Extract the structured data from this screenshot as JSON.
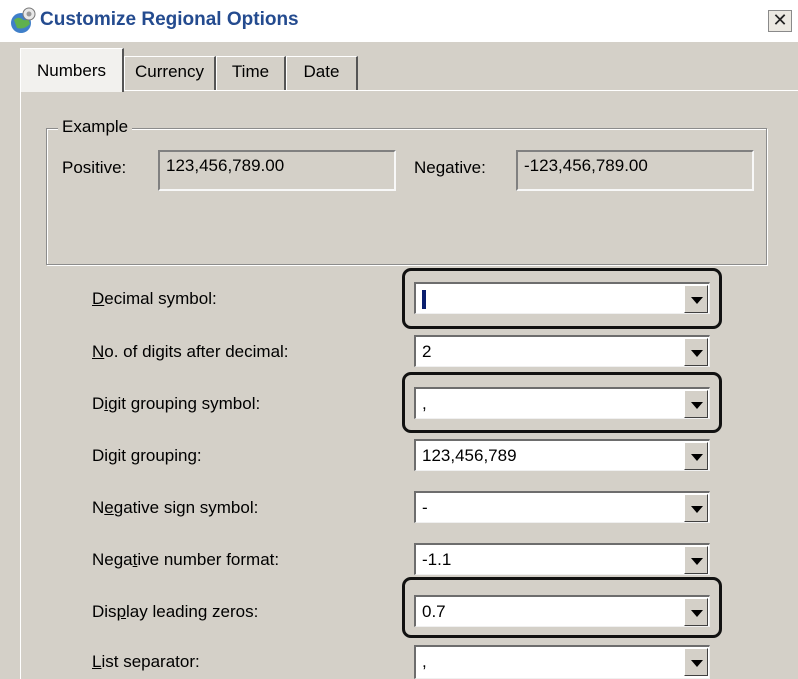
{
  "window": {
    "title": "Customize Regional Options",
    "close_symbol": "✕",
    "icon": "regional-globe-icon"
  },
  "tabs": [
    {
      "label": "Numbers",
      "active": true
    },
    {
      "label": "Currency",
      "active": false
    },
    {
      "label": "Time",
      "active": false
    },
    {
      "label": "Date",
      "active": false
    }
  ],
  "example": {
    "legend": "Example",
    "positive_label": "Positive:",
    "positive_value": "123,456,789.00",
    "negative_label": "Negative:",
    "negative_value": "-123,456,789.00"
  },
  "settings": [
    {
      "label_pre": "",
      "label_key": "D",
      "label_post": "ecimal symbol:",
      "value": "",
      "focused": true,
      "highlighted": true
    },
    {
      "label_pre": "",
      "label_key": "N",
      "label_post": "o. of digits after decimal:",
      "value": "2",
      "highlighted": false
    },
    {
      "label_pre": "D",
      "label_key": "i",
      "label_post": "git grouping symbol:",
      "value": ",",
      "highlighted": true
    },
    {
      "label_pre": "Di",
      "label_key": "g",
      "label_post": "it grouping:",
      "value": "123,456,789",
      "highlighted": false
    },
    {
      "label_pre": "N",
      "label_key": "e",
      "label_post": "gative sign symbol:",
      "value": "-",
      "highlighted": false
    },
    {
      "label_pre": "Nega",
      "label_key": "t",
      "label_post": "ive number format:",
      "value": "-1.1",
      "highlighted": false
    },
    {
      "label_pre": "Dis",
      "label_key": "p",
      "label_post": "lay leading zeros:",
      "value": "0.7",
      "highlighted": true
    },
    {
      "label_pre": "",
      "label_key": "L",
      "label_post": "ist separator:",
      "value": ",",
      "highlighted": false
    }
  ],
  "colors": {
    "title_text": "#244b8f",
    "dialog_face": "#d4d0c8",
    "highlight_border": "#111111"
  }
}
